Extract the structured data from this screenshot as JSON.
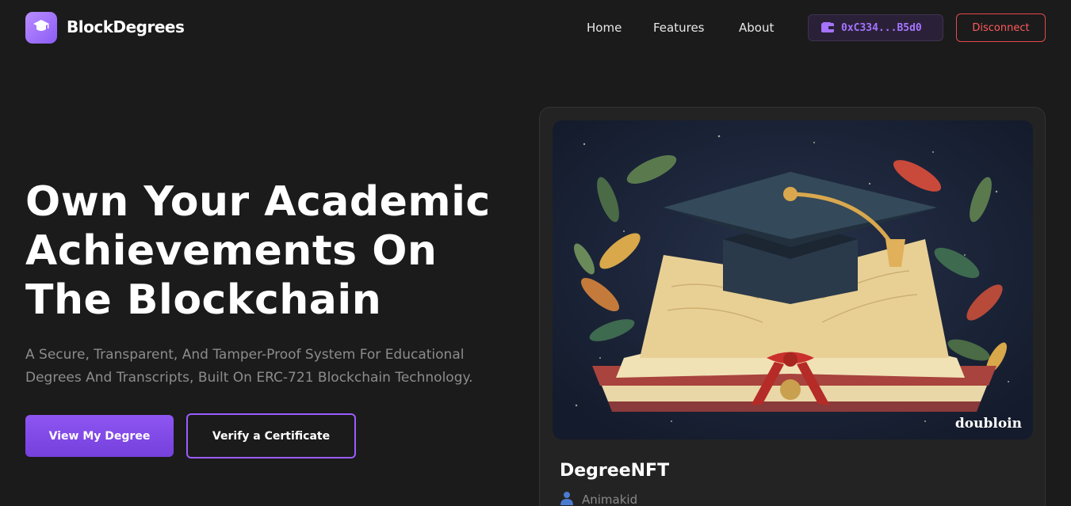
{
  "brand": {
    "name": "BlockDegrees",
    "icon": "graduation-cap-icon",
    "accent": "#9b6bff"
  },
  "nav": {
    "links": [
      "Home",
      "Features",
      "About"
    ],
    "wallet_address": "0xC334...B5d0",
    "wallet_icon": "wallet-icon",
    "disconnect_label": "Disconnect"
  },
  "hero": {
    "title": "Own Your Academic Achievements On The Blockchain",
    "subtitle": "A Secure, Transparent, And Tamper-Proof System For Educational Degrees And Transcripts, Built On ERC-721 Blockchain Technology.",
    "primary_button": "View My Degree",
    "secondary_button": "Verify a Certificate"
  },
  "nft_card": {
    "image_watermark": "doubloin",
    "title": "DegreeNFT",
    "owner_icon": "user-icon",
    "owner": "Animakid"
  },
  "colors": {
    "background": "#1b1b1b",
    "primary": "#8e55f2",
    "danger": "#e5484d",
    "wallet_text": "#a673ff"
  }
}
